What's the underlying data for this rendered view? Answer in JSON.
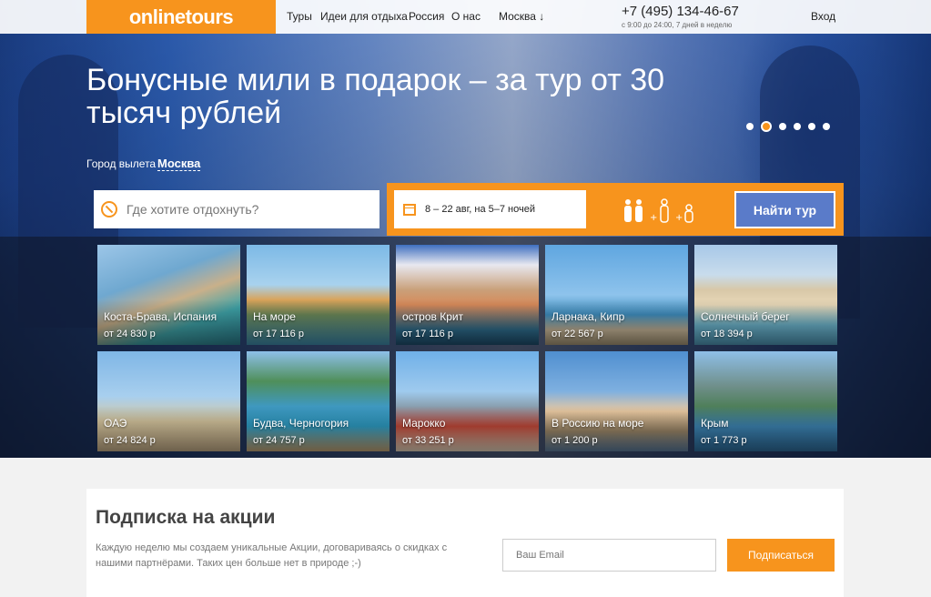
{
  "brand": {
    "logo": "onlinetours",
    "accent": "#f7941d",
    "button_blue": "#5a7bc9"
  },
  "nav": [
    "Туры",
    "Идеи для отдыха",
    "Россия",
    "О нас",
    "Москва ↓"
  ],
  "phone": {
    "number": "+7 (495) 134-46-67",
    "hours": "с 9:00 до 24:00, 7 дней в неделю"
  },
  "login": "Вход",
  "hero": {
    "headline": "Бонусные мили в подарок – за тур от 30 тысяч рублей",
    "slides_total": 6,
    "active_slide": 2
  },
  "departure": {
    "label": "Город вылета",
    "city": "Москва"
  },
  "search": {
    "placeholder": "Где хотите отдохнуть?",
    "dates": "8 – 22 авг, на 5–7 ночей",
    "button": "Найти тур"
  },
  "destinations": [
    {
      "name": "Коста-Брава, Испания",
      "price": "от 24 830 р"
    },
    {
      "name": "На море",
      "price": "от 17 116 р"
    },
    {
      "name": "остров Крит",
      "price": "от 17 116 р"
    },
    {
      "name": "Ларнака, Кипр",
      "price": "от 22 567 р"
    },
    {
      "name": "Солнечный берег",
      "price": "от 18 394 р"
    },
    {
      "name": "ОАЭ",
      "price": "от 24 824 р"
    },
    {
      "name": "Будва, Черногория",
      "price": "от 24 757 р"
    },
    {
      "name": "Марокко",
      "price": "от 33 251 р"
    },
    {
      "name": "В Россию на море",
      "price": "от 1 200 р"
    },
    {
      "name": "Крым",
      "price": "от 1 773 р"
    }
  ],
  "subscribe": {
    "title": "Подписка на акции",
    "text": "Каждую неделю мы создаем уникальные Акции, договариваясь о скидках с нашими партнёрами. Таких цен больше нет в природе ;-)",
    "email_placeholder": "Ваш Email",
    "button": "Подписаться"
  }
}
